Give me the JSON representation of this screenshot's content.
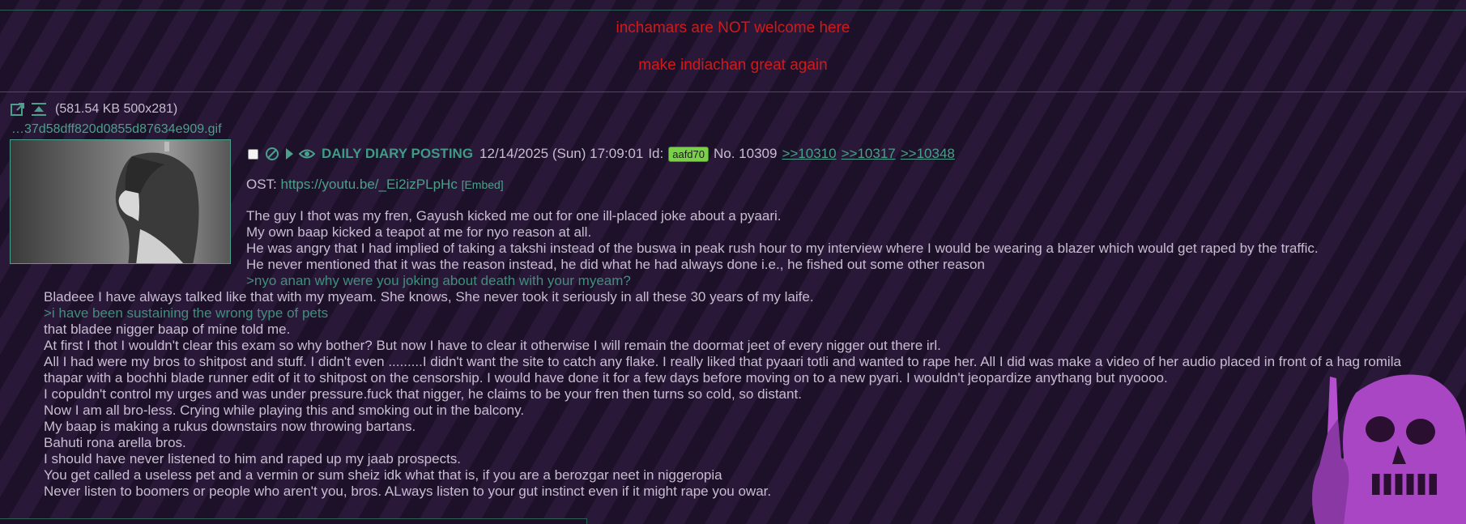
{
  "banner": {
    "line1": "inchamars are NOT welcome here",
    "line2": "make indiachan great again"
  },
  "post": {
    "file": {
      "info": "(581.54 KB  500x281)",
      "filename": "…37d58dff820d0855d87634e909.gif"
    },
    "subject": "DAILY DIARY POSTING",
    "date": "12/14/2025 (Sun) 17:09:01",
    "id_label": "Id:",
    "id": "aafd70",
    "number": "No. 10309",
    "backlinks": [
      ">>10310",
      ">>10317",
      ">>10348"
    ],
    "ost_label": "OST:",
    "ost_link": "https://youtu.be/_Ei2izPLpHc",
    "embed_label": "[Embed]",
    "lines": [
      {
        "text": "The guy  I thot was my fren, Gayush kicked me out for one ill-placed joke about a pyaari.",
        "greentext": false
      },
      {
        "text": "My own baap kicked a teapot at me for nyo reason at all.",
        "greentext": false
      },
      {
        "text": "He was angry that I had implied of taking a takshi instead of the buswa in peak rush hour to my interview where I would be wearing a blazer which would get raped by the traffic.",
        "greentext": false
      },
      {
        "text": "He never mentioned that it was the reason instead, he did what he had always done i.e., he fished out some other reason",
        "greentext": false
      },
      {
        "text": ">nyo anan why were you joking about death with your myeam?",
        "greentext": true
      },
      {
        "text": "Bladeee I have always talked like that with my myeam. She knows, She never took it seriously in all these 30 years of my laife.",
        "greentext": false
      },
      {
        "text": ">i have been sustaining the wrong type of pets",
        "greentext": true
      },
      {
        "text": "that bladee nigger baap of mine told me.",
        "greentext": false
      },
      {
        "text": "At first I thot I wouldn't clear this exam so why bother? But now I have to clear it otherwise I will remain the doormat jeet of every nigger out there irl.",
        "greentext": false
      },
      {
        "text": "All I had were my bros to shitpost and stuff. I didn't even .........I didn't want the site to catch any flake. I really liked that pyaari totli and wanted to rape her. All I did was make a video of her audio placed in front of a hag romila",
        "greentext": false
      },
      {
        "text": "thapar with a bochhi blade runner edit of it to shitpost on the censorship. I would have done it for a few days before moving on to a new pyari. I wouldn't jeopardize anythang but nyoooo.",
        "greentext": false
      },
      {
        "text": "I copuldn't control my urges and was under pressure.fuck that nigger, he claims to be your fren then turns so cold, so distant.",
        "greentext": false
      },
      {
        "text": "Now I am all bro-less. Crying while playing this and smoking out in the balcony.",
        "greentext": false
      },
      {
        "text": "My baap is making a  rukus downstairs now throwing bartans.",
        "greentext": false
      },
      {
        "text": "Bahuti rona arella bros.",
        "greentext": false
      },
      {
        "text": "I should have never listened to him and raped up my jaab prospects.",
        "greentext": false
      },
      {
        "text": "You get called a useless pet and a vermin or sum sheiz idk what that is, if you are a berozgar neet in niggeropia",
        "greentext": false
      },
      {
        "text": "Never listen to boomers or people who aren't you, bros. ALways listen to your gut instinct even if it might rape you owar.",
        "greentext": false
      }
    ]
  },
  "icons": {
    "open_external": "open-external-icon",
    "download": "download-icon",
    "hide": "hide-icon",
    "play": "play-icon",
    "watch": "eye-icon"
  },
  "colors": {
    "banner_red": "#d01a1a",
    "accent_teal": "#4aa08a",
    "greentext": "#3f8f7c",
    "id_badge": "#7bd04a",
    "skull_purple": "#b44fd0"
  }
}
